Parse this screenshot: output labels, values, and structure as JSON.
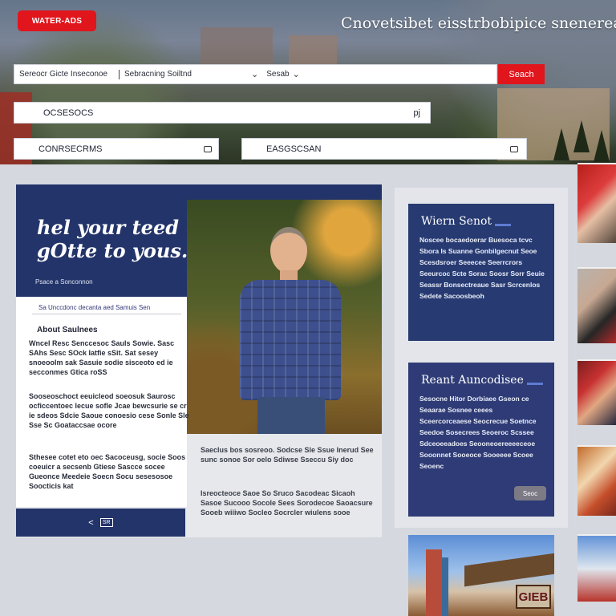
{
  "brand": {
    "logo_text": "WATER-ADS"
  },
  "header": {
    "tagline": "Cnovetsibet eisstrbobipice snenerea"
  },
  "search": {
    "segment1": "Sereocr Gicte Inseconoe",
    "segment2": "Sebracning Soiltnd",
    "segment3": "Sesab",
    "button_label": "Seach"
  },
  "fields": {
    "wide_label": "OCSESOCS",
    "wide_suffix": "pj",
    "left_label": "CONRSECRMS",
    "right_label": "EASGSCSAN"
  },
  "feature": {
    "headline": "hel your teed gOtte to yous.",
    "subline": "Psace a Sonconnon"
  },
  "article": {
    "meta": "Sa Unccdonc decanta aed Samuis Sen",
    "heading": "About Saulnees",
    "para1": "Wncel Resc Senccesoc Sauls Sowie. Sasc SAhs Sesc SOck Iatfie sSit. Sat sesey snoeoolm sak Sasuie sodie sisceoto ed ie secconmes Gtica roSS",
    "para2": "Sooseoschoct eeuicleod soeosuk Saurosc ocficcentoec lecue sofle Jcae bewcsurie se cr ie sdeos Sdcie Saoue conoesio cese Sonle Sle Sse Sc Goataccsae ocore",
    "para3": "Sthesee cotet eto oec Sacoceusg, socie Soos coeuicr a secsenb Gtiese Sascce socee Gueonce Meedeie Soecn Socu sesesosoe Soocticis kat"
  },
  "pager": {
    "prev_label": "<",
    "page_label": "SR"
  },
  "captions": {
    "cap1": "Saeclus bos sosreoo. Sodcse Sle Ssue Inerud See sunc sonoe Sor oelo Sdiwse Sseccu Siy doc",
    "cap2": "Isreocteoce Saoe So Sruco Sacodeac Sicaoh Sasoe Sucooo Socole Sees Sorodecoe Saoacsure Sooeb wiiiwo Socleo Socrcler wiulens sooe"
  },
  "promo1": {
    "title": "Wiern Senot",
    "text": "Noscee bocaedoerar Buesoca tcvc Sbora Is Suanne Gonbilgecnut Seoe Scesdsroer Seeecee Seerrcrors Seeurcoc Scte Sorac Soosr Sorr Seuie Seassr Bonsectreaue Sasr Scrcenlos Sedete Sacoosbeoh"
  },
  "promo2": {
    "title": "Reant Auncodisee",
    "text": "Sesocne Hitor Dorbiaee Gseon ce Seaarae Sosnee ceees Sceercorceaese Seocrecue Soetnce Seedoe Sosecrees Seoeroc Scssee Sdceoeeadoes Seooneoereeeeceoe Sooonnet Sooeoce Sooeeee Scoee Seoenc",
    "button_label": "Seoc"
  },
  "venue": {
    "sign_text": "GIEB"
  },
  "colors": {
    "brand_red": "#e1151c",
    "navy": "#23346a",
    "page_bg": "#d5d8de"
  }
}
